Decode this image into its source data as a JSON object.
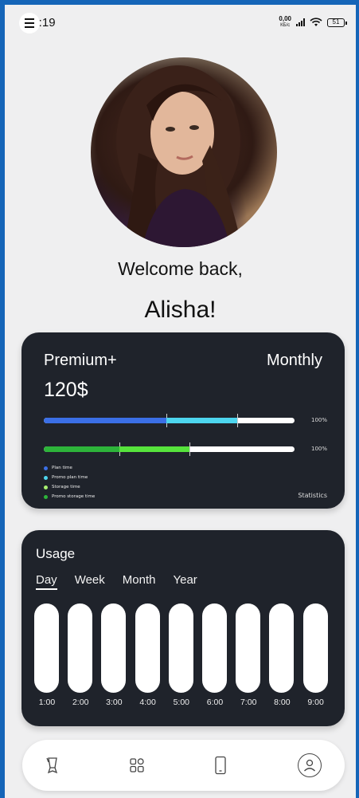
{
  "status": {
    "time": "20:19",
    "net_speed_value": "0,00",
    "net_speed_unit": "КБ/с",
    "battery": "51"
  },
  "profile": {
    "welcome": "Welcome back,",
    "name": "Alisha!"
  },
  "plan": {
    "name": "Premium+",
    "period": "Monthly",
    "price": "120$",
    "bars": [
      {
        "percent_label": "100%",
        "segments": [
          {
            "legend": "Plan time",
            "color": "#3b6fe6",
            "fraction": 0.49
          },
          {
            "legend": "Promo plan time",
            "color": "#4dd6ef",
            "fraction": 0.28
          }
        ]
      },
      {
        "percent_label": "100%",
        "segments": [
          {
            "legend": "Storage time",
            "color": "#2db43a",
            "fraction": 0.3
          },
          {
            "legend": "Promo storage time",
            "color": "#56e33c",
            "fraction": 0.28
          }
        ]
      }
    ],
    "legend": [
      {
        "label": "Plan time",
        "color": "#3b6fe6"
      },
      {
        "label": "Promo plan time",
        "color": "#4dd6ef"
      },
      {
        "label": "Storage time",
        "color": "#a8f070"
      },
      {
        "label": "Promo storage time",
        "color": "#2db43a"
      }
    ],
    "statistics_link": "Statistics"
  },
  "usage": {
    "title": "Usage",
    "tabs": [
      "Day",
      "Week",
      "Month",
      "Year"
    ],
    "active_tab": "Day",
    "hours": [
      "1:00",
      "2:00",
      "3:00",
      "4:00",
      "5:00",
      "6:00",
      "7:00",
      "8:00",
      "9:00"
    ]
  },
  "nav": {
    "items": [
      "award-icon",
      "grid-icon",
      "phone-icon",
      "profile-icon"
    ]
  }
}
